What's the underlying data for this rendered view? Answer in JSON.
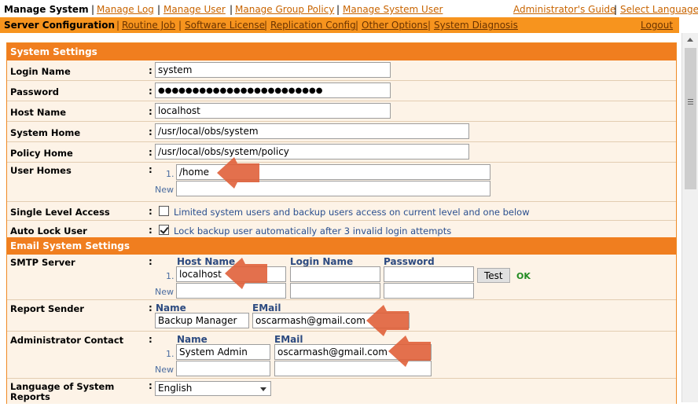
{
  "topnav": {
    "current": "Manage System",
    "links": [
      "Manage Log",
      "Manage User",
      "Manage Group Policy",
      "Manage System User"
    ],
    "right_links": [
      "Administrator's Guide",
      "Select Language"
    ]
  },
  "subnav": {
    "current": "Server Configuration",
    "links": [
      "Routine Job",
      "Software License",
      "Replication Config",
      "Other Options",
      "System Diagnosis"
    ],
    "logout": "Logout"
  },
  "system_settings": {
    "header": "System Settings",
    "login_name": {
      "label": "Login Name",
      "value": "system"
    },
    "password": {
      "label": "Password",
      "value": "●●●●●●●●●●●●●●●●●●●●●●●●"
    },
    "host_name": {
      "label": "Host Name",
      "value": "localhost"
    },
    "system_home": {
      "label": "System Home",
      "value": "/usr/local/obs/system"
    },
    "policy_home": {
      "label": "Policy Home",
      "value": "/usr/local/obs/system/policy"
    },
    "user_homes": {
      "label": "User Homes",
      "index": "1.",
      "value": "/home",
      "new_label": "New",
      "new_value": ""
    },
    "single_level_access": {
      "label": "Single Level Access",
      "checked": false,
      "text": "Limited system users and backup users access on current level and one below"
    },
    "auto_lock_user": {
      "label": "Auto Lock User",
      "checked": true,
      "text": "Lock backup user automatically after 3 invalid login attempts"
    }
  },
  "email_settings": {
    "header": "Email System Settings",
    "smtp": {
      "label": "SMTP Server",
      "col_host": "Host Name",
      "col_login": "Login Name",
      "col_password": "Password",
      "index": "1.",
      "host": "localhost",
      "login": "",
      "password": "",
      "new_label": "New",
      "test_button": "Test",
      "status": "OK"
    },
    "report_sender": {
      "label": "Report Sender",
      "col_name": "Name",
      "col_email": "EMail",
      "name": "Backup Manager",
      "email": "oscarmash@gmail.com"
    },
    "admin_contact": {
      "label": "Administrator Contact",
      "col_name": "Name",
      "col_email": "EMail",
      "index": "1.",
      "name": "System Admin",
      "email": "oscarmash@gmail.com",
      "new_label": "New"
    },
    "language": {
      "label_line1": "Language of System",
      "label_line2": "Reports",
      "value": "English"
    }
  },
  "colors": {
    "accent": "#f07e1f",
    "nav_bar": "#f7941e",
    "panel_bg": "#fdf3e7",
    "arrow": "#e0603a",
    "link": "#c86400"
  },
  "colons": ":"
}
